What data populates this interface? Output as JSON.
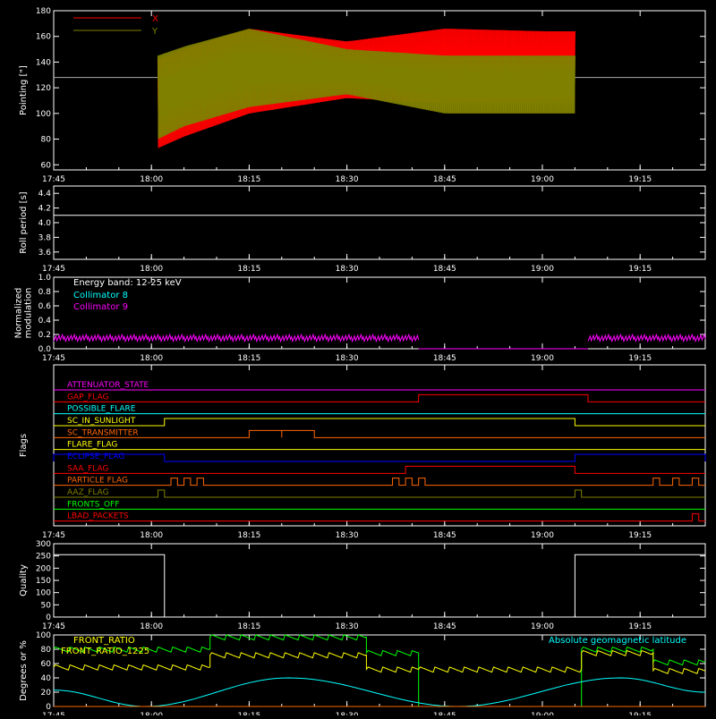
{
  "time_ticks": [
    "17:45",
    "18:00",
    "18:15",
    "18:30",
    "18:45",
    "19:00",
    "19:15"
  ],
  "colors": {
    "axis": "#ffffff",
    "x_series": "#ff0000",
    "y_series": "#808000",
    "cyan": "#00ffff",
    "magenta": "#ff00ff",
    "green": "#00ff00",
    "yellow": "#ffff00",
    "orange": "#ff6600",
    "blue": "#0000ff"
  },
  "chart_data": [
    {
      "id": "pointing",
      "type": "area",
      "ylabel": "Pointing [\"]",
      "ylim": [
        56,
        180
      ],
      "yticks": [
        60,
        80,
        100,
        120,
        140,
        160,
        180
      ],
      "legend": [
        "X",
        "Y"
      ],
      "reference_line": 128,
      "data_start": "18:01",
      "data_end": "19:05",
      "series": [
        {
          "name": "X",
          "time": [
            "18:01",
            "18:05",
            "18:15",
            "18:30",
            "18:45",
            "19:00",
            "19:05"
          ],
          "min": [
            73,
            82,
            100,
            112,
            108,
            110,
            110
          ],
          "max": [
            142,
            150,
            166,
            156,
            166,
            164,
            164
          ]
        },
        {
          "name": "Y",
          "time": [
            "18:01",
            "18:05",
            "18:15",
            "18:30",
            "18:45",
            "19:00",
            "19:05"
          ],
          "min": [
            80,
            90,
            105,
            115,
            100,
            100,
            100
          ],
          "max": [
            145,
            152,
            166,
            150,
            145,
            145,
            145
          ]
        }
      ]
    },
    {
      "id": "roll",
      "type": "line",
      "ylabel": "Roll period [s]",
      "ylim": [
        3.5,
        4.5
      ],
      "yticks": [
        3.6,
        3.8,
        4.0,
        4.2,
        4.4
      ],
      "value": 4.1
    },
    {
      "id": "modulation",
      "type": "line",
      "ylabel": "Normalized modulation",
      "ylim": [
        0,
        1
      ],
      "yticks": [
        0.0,
        0.2,
        0.4,
        0.6,
        0.8,
        1.0
      ],
      "legend_title": "Energy band: 12-25 keV",
      "legend": [
        "Collimator 8",
        "Collimator 9"
      ],
      "segments": [
        {
          "from": "17:45",
          "to": "18:41",
          "level": 0.15
        },
        {
          "from": "19:07",
          "to": "19:25",
          "level": 0.15
        }
      ]
    },
    {
      "id": "flags",
      "type": "line",
      "ylabel": "Flags",
      "flags": [
        {
          "name": "ATTENUATOR_STATE",
          "color": "#ff00ff",
          "on": []
        },
        {
          "name": "GAP_FLAG",
          "color": "#ff0000",
          "on": [
            [
              "18:41",
              "19:07"
            ]
          ]
        },
        {
          "name": "POSSIBLE_FLARE",
          "color": "#00ffff",
          "on": []
        },
        {
          "name": "SC_IN_SUNLIGHT",
          "color": "#ffff00",
          "on": [
            [
              "18:02",
              "19:05"
            ]
          ]
        },
        {
          "name": "SC_TRANSMITTER",
          "color": "#ff6600",
          "on": [
            [
              "18:15",
              "18:20"
            ],
            [
              "18:20",
              "18:25"
            ]
          ]
        },
        {
          "name": "FLARE_FLAG",
          "color": "#ffff00",
          "on": []
        },
        {
          "name": "ECLIPSE_FLAG",
          "color": "#0000ff",
          "on": [
            [
              "17:45",
              "18:02"
            ],
            [
              "19:05",
              "19:25"
            ]
          ]
        },
        {
          "name": "SAA_FLAG",
          "color": "#ff0000",
          "on": [
            [
              "18:39",
              "19:05"
            ]
          ]
        },
        {
          "name": "PARTICLE FLAG",
          "color": "#ff6600",
          "on": [
            [
              "18:03",
              "18:04"
            ],
            [
              "18:05",
              "18:06"
            ],
            [
              "18:07",
              "18:08"
            ],
            [
              "18:37",
              "18:38"
            ],
            [
              "18:39",
              "18:40"
            ],
            [
              "18:41",
              "18:42"
            ],
            [
              "19:17",
              "19:18"
            ],
            [
              "19:20",
              "19:21"
            ],
            [
              "19:23",
              "19:24"
            ]
          ]
        },
        {
          "name": "AAZ_FLAG",
          "color": "#808000",
          "on": [
            [
              "18:01",
              "18:02"
            ],
            [
              "19:05",
              "19:06"
            ]
          ]
        },
        {
          "name": "FRONTS_OFF",
          "color": "#00ff00",
          "on": []
        },
        {
          "name": "LBAD_PACKETS",
          "color": "#ff0000",
          "on": [
            [
              "19:23",
              "19:24"
            ]
          ]
        }
      ]
    },
    {
      "id": "quality",
      "type": "line",
      "ylabel": "Quality",
      "ylim": [
        0,
        300
      ],
      "yticks": [
        0,
        50,
        100,
        150,
        200,
        250,
        300
      ],
      "segments": [
        {
          "from": "17:45",
          "to": "18:02",
          "level": 255
        },
        {
          "from": "18:02",
          "to": "19:05",
          "level": 0
        },
        {
          "from": "19:05",
          "to": "19:25",
          "level": 255
        }
      ]
    },
    {
      "id": "ratios",
      "type": "line",
      "ylabel": "Degrees or %",
      "ylim": [
        0,
        100
      ],
      "yticks": [
        0,
        20,
        40,
        60,
        80,
        100
      ],
      "legend": [
        "FRONT_RATIO",
        "FRONT_RATIO_1225"
      ],
      "annotation": "Absolute geomagnetic latitude",
      "series": [
        {
          "name": "FRONT_RATIO",
          "color": "#00ff00",
          "time": [
            "17:45",
            "18:09",
            "18:09",
            "18:33",
            "18:33",
            "18:41",
            "18:41",
            "19:06",
            "19:06",
            "19:17",
            "19:17",
            "19:25"
          ],
          "values": [
            80,
            80,
            97,
            97,
            75,
            75,
            0,
            0,
            80,
            80,
            62,
            62
          ]
        },
        {
          "name": "FRONT_RATIO_1225",
          "color": "#ffff00",
          "time": [
            "17:45",
            "18:09",
            "18:09",
            "18:33",
            "18:33",
            "18:41",
            "19:06",
            "19:06",
            "19:17",
            "19:17",
            "19:25"
          ],
          "values": [
            55,
            55,
            72,
            72,
            52,
            52,
            52,
            75,
            75,
            50,
            50
          ]
        },
        {
          "name": "Absolute geomagnetic latitude",
          "color": "#00ffff",
          "time": [
            "17:45",
            "17:59",
            "18:21",
            "18:47",
            "19:12",
            "19:25"
          ],
          "values": [
            23,
            0,
            40,
            0,
            40,
            20
          ]
        }
      ]
    }
  ]
}
